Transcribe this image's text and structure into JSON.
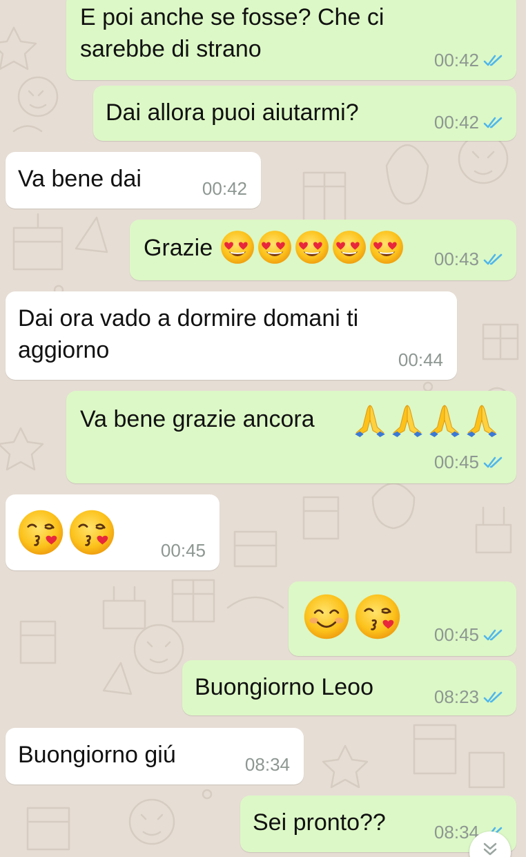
{
  "theme": {
    "outgoing_bubble": "#dcf8c6",
    "incoming_bubble": "#ffffff",
    "read_tick_color": "#4fb6ec",
    "wallpaper": "#e6ddd4"
  },
  "messages": [
    {
      "direction": "out",
      "lines": [
        "E poi anche se fosse? Che ci",
        "sarebbe di strano"
      ],
      "time": "00:42",
      "status": "read"
    },
    {
      "direction": "out",
      "lines": [
        "Dai allora puoi aiutarmi?"
      ],
      "time": "00:42",
      "status": "read"
    },
    {
      "direction": "in",
      "lines": [
        "Va bene dai"
      ],
      "time": "00:42"
    },
    {
      "direction": "out",
      "lines": [
        "Grazie"
      ],
      "emojis": [
        "heart-eyes",
        "heart-eyes",
        "heart-eyes",
        "heart-eyes",
        "heart-eyes"
      ],
      "time": "00:43",
      "status": "read"
    },
    {
      "direction": "in",
      "lines": [
        "Dai ora vado a dormire domani ti",
        "aggiorno"
      ],
      "time": "00:44"
    },
    {
      "direction": "out",
      "lines": [
        "Va bene grazie ancora"
      ],
      "emojis": [
        "folded-hands",
        "folded-hands",
        "folded-hands",
        "folded-hands"
      ],
      "time": "00:45",
      "status": "read"
    },
    {
      "direction": "in",
      "lines": [],
      "emojis": [
        "kissing-heart",
        "kissing-heart"
      ],
      "time": "00:45"
    },
    {
      "direction": "out",
      "lines": [],
      "emojis": [
        "smiling-blush",
        "kissing-heart"
      ],
      "time": "00:45",
      "status": "read"
    },
    {
      "direction": "out",
      "lines": [
        "Buongiorno Leoo"
      ],
      "time": "08:23",
      "status": "read"
    },
    {
      "direction": "in",
      "lines": [
        "Buongiorno giú"
      ],
      "time": "08:34"
    },
    {
      "direction": "out",
      "lines": [
        "Sei pronto??"
      ],
      "time": "08:34",
      "status": "read"
    }
  ],
  "scroll_button_icon": "double-chevron-down-icon"
}
